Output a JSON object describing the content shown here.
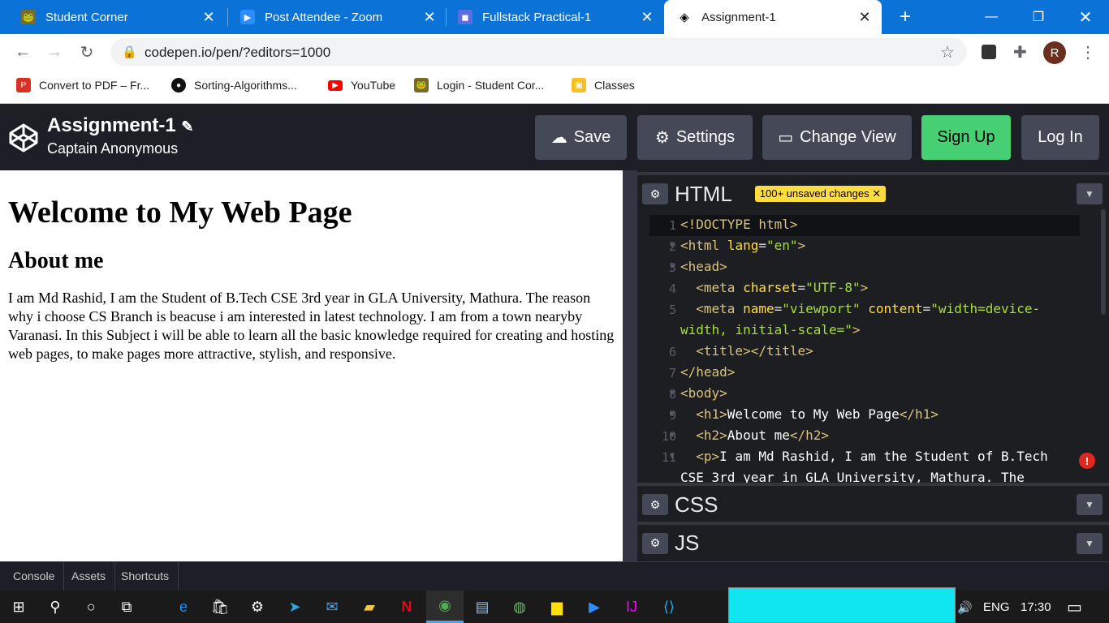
{
  "browser": {
    "tabs": [
      {
        "title": "Student Corner",
        "active": false
      },
      {
        "title": "Post Attendee - Zoom",
        "active": false
      },
      {
        "title": "Fullstack Practical-1",
        "active": false
      },
      {
        "title": "Assignment-1",
        "active": true
      }
    ],
    "url": "codepen.io/pen/?editors=1000",
    "profile_initial": "R",
    "bookmarks": [
      "Convert to PDF – Fr...",
      "Sorting-Algorithms...",
      "YouTube",
      "Login - Student Cor...",
      "Classes"
    ]
  },
  "codepen": {
    "pen_title": "Assignment-1",
    "author": "Captain Anonymous",
    "buttons": {
      "save": "Save",
      "settings": "Settings",
      "change_view": "Change View",
      "sign_up": "Sign Up",
      "log_in": "Log In"
    },
    "colors": {
      "signup": "#47cf73",
      "button": "#444857",
      "header": "#1e1f26"
    }
  },
  "preview": {
    "h1": "Welcome to My Web Page",
    "h2": "About me",
    "paragraph": "I am Md Rashid, I am the Student of B.Tech CSE 3rd year in GLA University, Mathura. The reason why i choose CS Branch is beacuse i am interested in latest technology. I am from a town nearyby Varanasi. In this Subject i will be able to learn all the basic knowledge required for creating and hosting web pages, to make pages more attractive, stylish, and responsive."
  },
  "editors": {
    "html_label": "HTML",
    "unsaved_badge": "100+ unsaved changes",
    "css_label": "CSS",
    "js_label": "JS",
    "line_numbers": [
      "1",
      "2",
      "3",
      "4",
      "5",
      "",
      "6",
      "7",
      "8",
      "9",
      "10",
      "11"
    ]
  },
  "bottom_bar": [
    "Console",
    "Assets",
    "Shortcuts"
  ],
  "taskbar": {
    "language": "ENG",
    "time": "17:30"
  }
}
